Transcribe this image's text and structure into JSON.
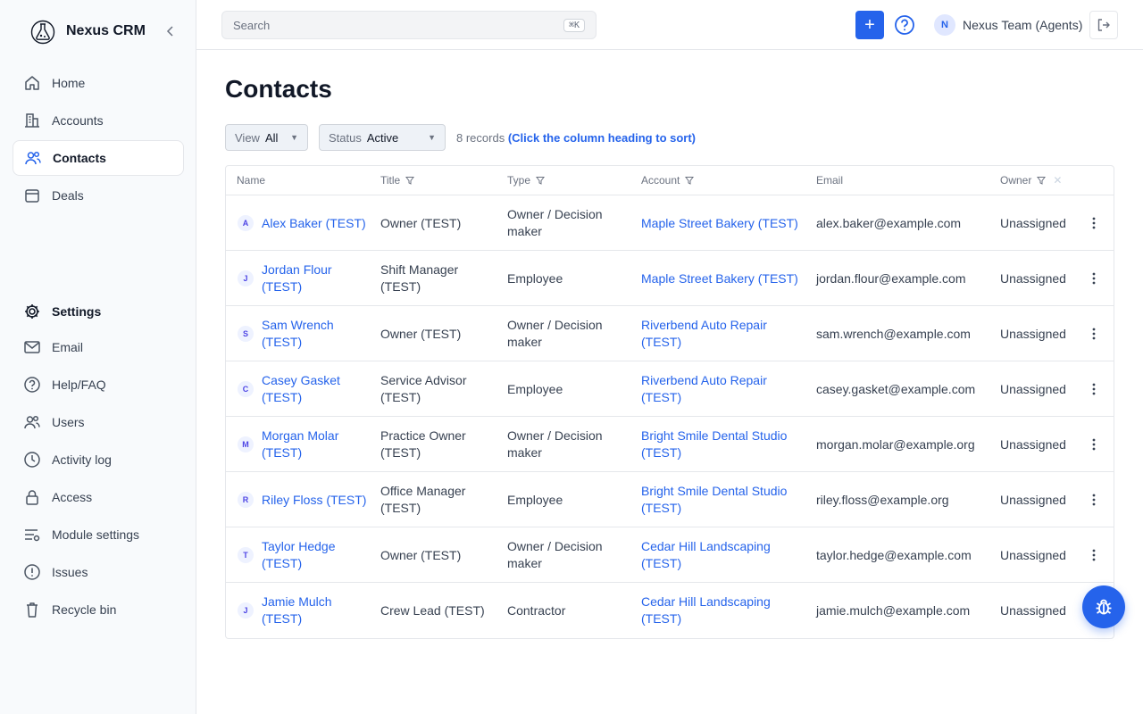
{
  "app": {
    "name": "Nexus CRM"
  },
  "sidebar": {
    "primary": [
      {
        "label": "Home",
        "icon": "home-icon"
      },
      {
        "label": "Accounts",
        "icon": "building-icon"
      },
      {
        "label": "Contacts",
        "icon": "users-icon",
        "active": true
      },
      {
        "label": "Deals",
        "icon": "calendar-icon"
      }
    ],
    "settings_header": {
      "label": "Settings",
      "icon": "gear-icon"
    },
    "secondary": [
      {
        "label": "Email",
        "icon": "mail-icon"
      },
      {
        "label": "Help/FAQ",
        "icon": "help-icon"
      },
      {
        "label": "Users",
        "icon": "users-icon"
      },
      {
        "label": "Activity log",
        "icon": "clock-icon"
      },
      {
        "label": "Access",
        "icon": "lock-icon"
      },
      {
        "label": "Module settings",
        "icon": "sliders-icon"
      },
      {
        "label": "Issues",
        "icon": "alert-icon"
      },
      {
        "label": "Recycle bin",
        "icon": "trash-icon"
      }
    ]
  },
  "topbar": {
    "search_placeholder": "Search",
    "search_shortcut": "⌘K",
    "add_label": "+",
    "user_initial": "N",
    "user_name": "Nexus Team (Agents)"
  },
  "page": {
    "title": "Contacts",
    "view_filter": {
      "label": "View",
      "value": "All"
    },
    "status_filter": {
      "label": "Status",
      "value": "Active"
    },
    "records_count": "8 records",
    "sort_hint": "(Click the column heading to sort)"
  },
  "table": {
    "columns": [
      "Name",
      "Title",
      "Type",
      "Account",
      "Email",
      "Owner"
    ],
    "rows": [
      {
        "initial": "A",
        "name": "Alex Baker (TEST)",
        "title": "Owner (TEST)",
        "type": "Owner / Decision maker",
        "account": "Maple Street Bakery (TEST)",
        "email": "alex.baker@example.com",
        "owner": "Unassigned"
      },
      {
        "initial": "J",
        "name": "Jordan Flour (TEST)",
        "title": "Shift Manager (TEST)",
        "type": "Employee",
        "account": "Maple Street Bakery (TEST)",
        "email": "jordan.flour@example.com",
        "owner": "Unassigned"
      },
      {
        "initial": "S",
        "name": "Sam Wrench (TEST)",
        "title": "Owner (TEST)",
        "type": "Owner / Decision maker",
        "account": "Riverbend Auto Repair (TEST)",
        "email": "sam.wrench@example.com",
        "owner": "Unassigned"
      },
      {
        "initial": "C",
        "name": "Casey Gasket (TEST)",
        "title": "Service Advisor (TEST)",
        "type": "Employee",
        "account": "Riverbend Auto Repair (TEST)",
        "email": "casey.gasket@example.com",
        "owner": "Unassigned"
      },
      {
        "initial": "M",
        "name": "Morgan Molar (TEST)",
        "title": "Practice Owner (TEST)",
        "type": "Owner / Decision maker",
        "account": "Bright Smile Dental Studio (TEST)",
        "email": "morgan.molar@example.org",
        "owner": "Unassigned"
      },
      {
        "initial": "R",
        "name": "Riley Floss (TEST)",
        "title": "Office Manager (TEST)",
        "type": "Employee",
        "account": "Bright Smile Dental Studio (TEST)",
        "email": "riley.floss@example.org",
        "owner": "Unassigned"
      },
      {
        "initial": "T",
        "name": "Taylor Hedge (TEST)",
        "title": "Owner (TEST)",
        "type": "Owner / Decision maker",
        "account": "Cedar Hill Landscaping (TEST)",
        "email": "taylor.hedge@example.com",
        "owner": "Unassigned"
      },
      {
        "initial": "J",
        "name": "Jamie Mulch (TEST)",
        "title": "Crew Lead (TEST)",
        "type": "Contractor",
        "account": "Cedar Hill Landscaping (TEST)",
        "email": "jamie.mulch@example.com",
        "owner": "Unassigned"
      }
    ]
  },
  "colors": {
    "accent": "#2563eb",
    "sidebar_bg": "#f8fafc",
    "border": "#e5e7eb"
  }
}
